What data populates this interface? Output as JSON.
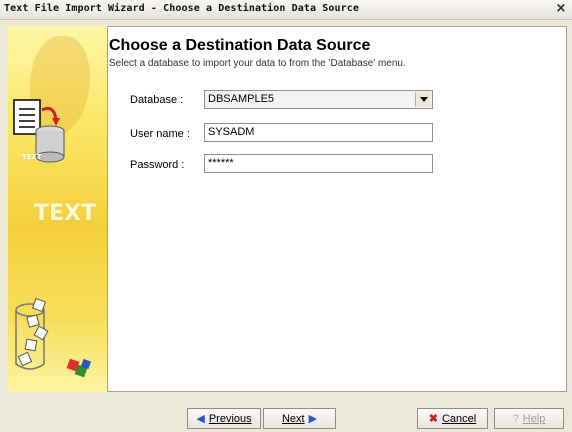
{
  "window": {
    "title": "Text File Import Wizard - Choose a Destination Data Source",
    "close_glyph": "×"
  },
  "banner": {
    "tag": "TEXT",
    "watermark": "TEXT"
  },
  "page": {
    "heading": "Choose a Destination Data Source",
    "subheading": "Select a database to import your data to from the 'Database' menu."
  },
  "form": {
    "database_label": "Database :",
    "database_value": "DBSAMPLE5",
    "username_label": "User name :",
    "username_value": "SYSADM",
    "password_label": "Password :",
    "password_value": "******"
  },
  "buttons": {
    "previous": "Previous",
    "next": "Next",
    "cancel": "Cancel",
    "help": "Help"
  },
  "icons": {
    "previous": "arrow-left-icon",
    "next": "arrow-right-icon",
    "cancel": "x-icon",
    "help": "question-icon"
  }
}
